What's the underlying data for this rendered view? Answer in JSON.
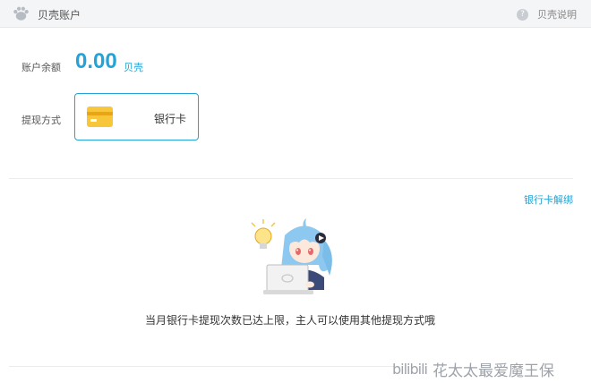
{
  "header": {
    "title": "贝壳账户",
    "help_label": "贝壳说明",
    "help_icon_glyph": "?"
  },
  "balance": {
    "label": "账户余额",
    "amount": "0.00",
    "unit": "贝壳"
  },
  "withdraw": {
    "label": "提现方式",
    "method_name": "银行卡"
  },
  "unbind_link": "银行卡解绑",
  "notice": "当月银行卡提现次数已达上限，主人可以使用其他提现方式哦",
  "watermark": {
    "logo": "bilibili",
    "text": "花太太最爱魔王保"
  },
  "colors": {
    "accent": "#23a3d6",
    "card_yellow": "#f7c63a"
  }
}
